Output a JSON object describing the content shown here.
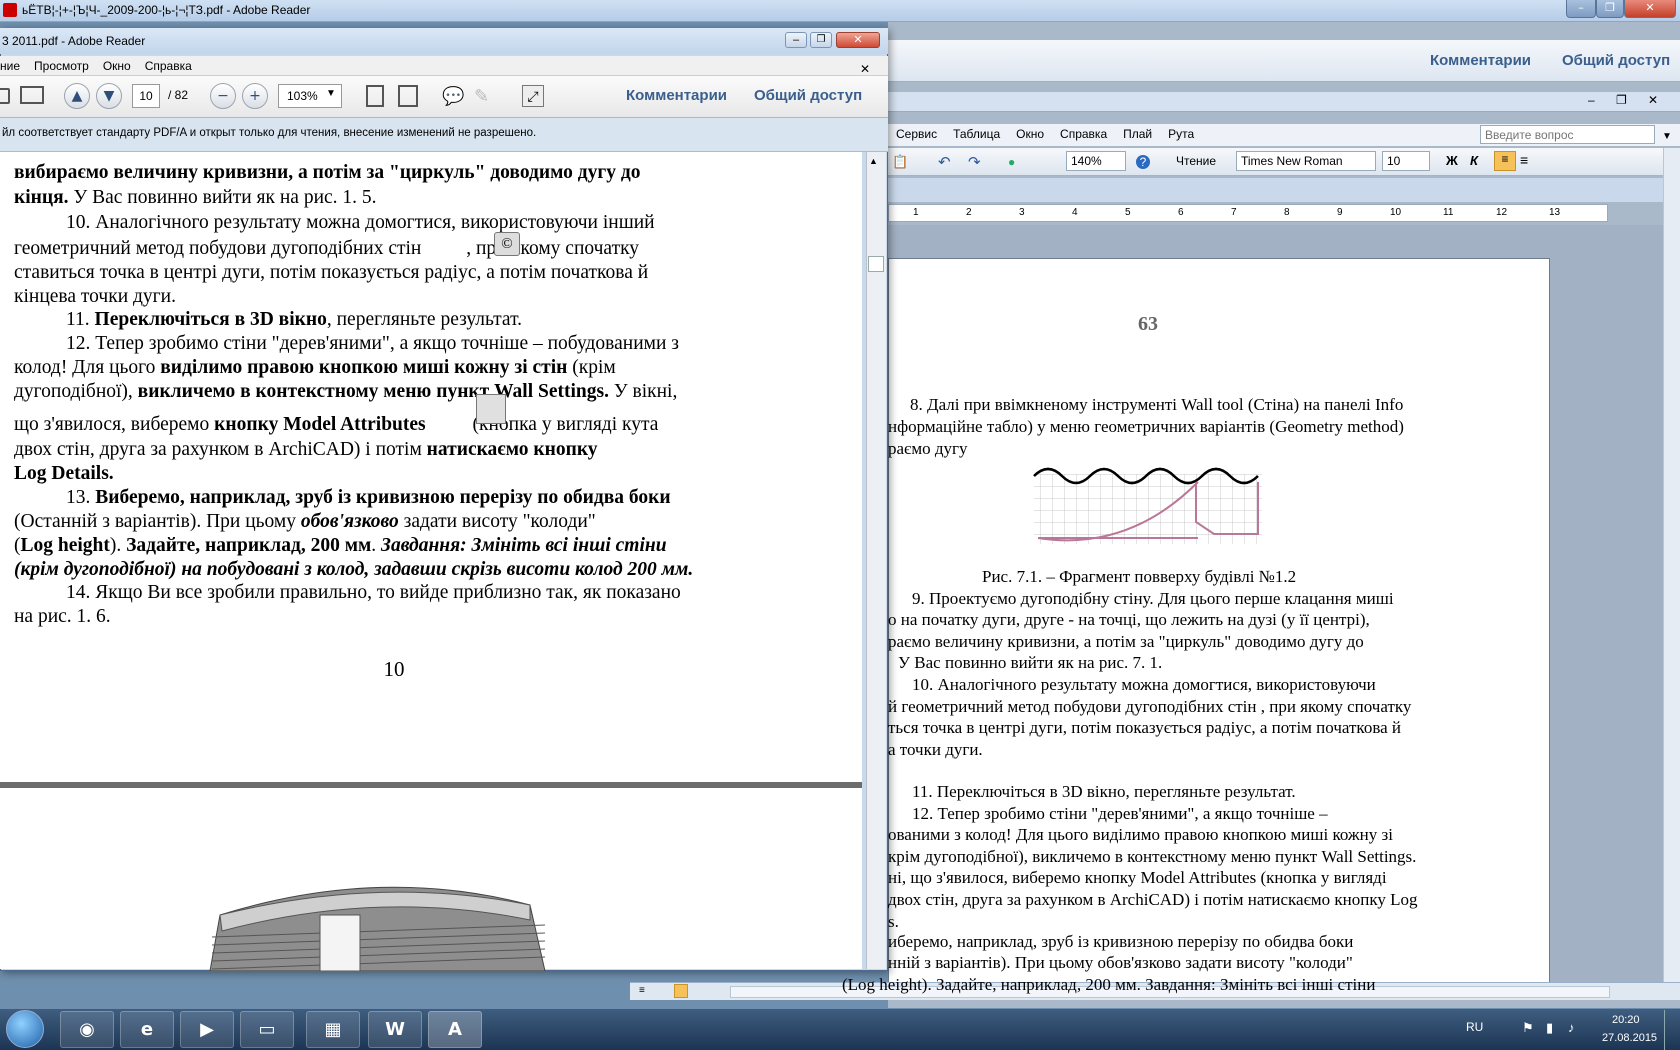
{
  "bg_window": {
    "title": "ьЁТВ¦-¦+-¦Ъ¦Ч-_2009-200-¦ь-¦¬¦ТЗ.pdf - Adobe Reader",
    "comments_label": "Комментарии",
    "share_label": "Общий доступ"
  },
  "word": {
    "menu": [
      "Сервис",
      "Таблица",
      "Окно",
      "Справка",
      "Плай",
      "Рута"
    ],
    "search_placeholder": "Введите вопрос",
    "zoom": "140%",
    "read_label": "Чтение",
    "font_name": "Times New Roman",
    "font_size": "10",
    "bold_label": "Ж",
    "italic_label": "К",
    "ruler_ticks": [
      "1",
      "2",
      "3",
      "4",
      "5",
      "6",
      "7",
      "8",
      "9",
      "10",
      "11",
      "12",
      "13"
    ],
    "page_number": "63",
    "lines": [
      "8. Далі при ввімкненому інструменті Wall tool (Стіна) на панелі Info",
      "нформаційне табло) у меню геометричних варіантів (Geometry method)",
      "раємо дугу",
      "Рис. 7.1. – Фрагмент повверху будівлі №1.2",
      "9. Проектуємо дугоподібну стіну. Для цього перше клацання миші",
      "о на початку дуги, друге - на точці, що лежить на дузі (у її центрі),",
      "раємо величину кривизни, а потім за \"циркуль\" доводимо дугу до",
      "У Вас повинно вийти як на рис. 7. 1.",
      "10. Аналогічного результату можна домогтися, використовуючи",
      "й геометричний метод побудови дугоподібних стін , при якому спочатку",
      "ться точка в центрі дуги, потім показується радіус, а потім початкова й",
      "а точки дуги.",
      "11. Переключіться в 3D вікно, перегляньте результат.",
      "12. Тепер зробимо стіни \"дерев'яними\", а якщо точніше –",
      "ованими з колод! Для цього виділимо правою кнопкою миші кожну зі",
      "крім дугоподібної), викличемо в контекстному меню пункт Wall Settings.",
      "ні, що з'явилося, виберемо кнопку Model Attributes (кнопка у вигляді",
      "двох стін, друга за рахунком в ArchiCAD) і потім натискаємо кнопку Log",
      "s.",
      "иберемо, наприклад, зруб із кривизною перерізу по обидва боки",
      "нній з варіантів). При цьому обов'язково задати висоту \"колоди\"",
      "(Log height). Задайте, наприклад, 200 мм. Завдання: Змініть всі інші стіни"
    ]
  },
  "front": {
    "title": "3 2011.pdf - Adobe Reader",
    "menu": [
      "ние",
      "Просмотр",
      "Окно",
      "Справка"
    ],
    "page_current": "10",
    "page_total": "/ 82",
    "zoom": "103%",
    "comments_label": "Комментарии",
    "share_label": "Общий доступ",
    "info_bar": "йл соответствует стандарту PDF/A и открыт только для чтения, внесение изменений не разрешено.",
    "page_number": "10",
    "paragraphs": {
      "p0a": "вибираємо величину кривизни, а потім за \"циркуль\" доводимо дугу до",
      "p0b": "кінця.",
      "p0c": " У Вас повинно вийти як на рис. 1. 5.",
      "p10a": "10. Аналогічного результату можна домогтися, використовуючи інший",
      "p10b": "геометричний метод побудови дугоподібних стін",
      "p10c": ", при якому спочатку",
      "p10d": "ставиться точка в центрі дуги, потім показується радіус, а потім початкова й",
      "p10e": "кінцева точки дуги.",
      "p11a": "11. ",
      "p11b": "Переключіться в 3D вікно",
      "p11c": ", перегляньте результат.",
      "p12a": "12. Тепер зробимо стіни \"дерев'яними\", а якщо точніше – побудованими з",
      "p12b": "колод! Для цього ",
      "p12c": "виділимо правою кнопкою миші кожну зі стін",
      "p12d": " (крім",
      "p12e": "дугоподібної), ",
      "p12f": "викличемо в контекстному меню пункт Wall Settings.",
      "p12g": " У вікні,",
      "p12h": "що з'явилося, виберемо ",
      "p12i": "кнопку Model Attributes",
      "p12j": " (кнопка у вигляді кута",
      "p12k": "двох стін, друга за рахунком в ArchiCAD) і потім ",
      "p12l": "натискаємо кнопку",
      "p12m": "Log Details.",
      "p13a": "13. ",
      "p13b": "Виберемо, наприклад, зруб із кривизною перерізу по обидва боки",
      "p13c": "(Останній з варіантів). При цьому ",
      "p13d": "обов'язково",
      "p13e": " задати висоту \"колоди\"",
      "p13f": "(",
      "p13g": "Log height",
      "p13h": "). ",
      "p13i": "Задайте, наприклад, 200 мм",
      "p13j": ". ",
      "p13k": "Завдання: Змініть всі інші стіни",
      "p13l": "(крім дугоподібної) на побудовані з колод, задавши скрізь висоти колод 200 мм.",
      "p14a": "14. Якщо Ви все зробили правильно, то вийде приблизно так, як показано",
      "p14b": "на рис. 1. 6."
    }
  },
  "taskbar": {
    "lang": "RU",
    "time": "20:20",
    "date": "27.08.2015"
  }
}
